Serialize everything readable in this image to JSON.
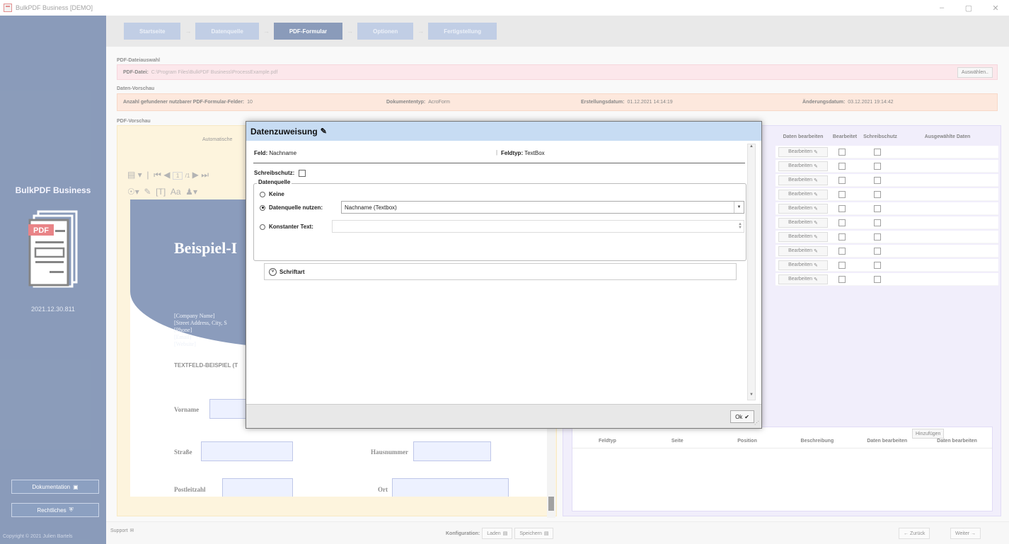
{
  "window": {
    "title": "BulkPDF Business [DEMO]",
    "minimize": "–",
    "maximize": "▢",
    "close": "✕"
  },
  "sidebar": {
    "product": "BulkPDF Business",
    "logo_badge": "PDF",
    "version": "2021.12.30.811",
    "doc_button": "Dokumentation",
    "legal_button": "Rechtliches",
    "copyright": "Copyright © 2021 Julien Bartels"
  },
  "wizard": {
    "steps": [
      "Startseite",
      "Datenquelle",
      "PDF-Formular",
      "Optionen",
      "Fertigstellung"
    ],
    "active_index": 2
  },
  "file_section": {
    "label": "PDF-Dateiauswahl",
    "field_label": "PDF-Datei:",
    "path": "C:\\Program Files\\BulkPDF Business\\ProcessExample.pdf",
    "choose_button": "Auswählen.."
  },
  "data_preview": {
    "label": "Daten-Vorschau",
    "field_count_label": "Anzahl gefundener nutzbarer PDF-Formular-Felder:",
    "field_count": "10",
    "doctype_label": "Dokumententyp:",
    "doctype": "AcroForm",
    "created_label": "Erstellungsdatum:",
    "created": "01.12.2021 14:14:19",
    "modified_label": "Änderungsdatum:",
    "modified": "03.12.2021 19:14:42"
  },
  "pdf_preview": {
    "label": "PDF-Vorschau",
    "auto_label": "Automatische",
    "page_input": "1",
    "page_total": "/1",
    "heading": "Beispiel-I",
    "company_block": "[Company Name]\n[Street Address, City, S\n[Phone]\n[Email]\n[Website]",
    "textfield_heading": "TEXTFELD-BEISPIEL (T",
    "field_labels": [
      "Vorname",
      "Straße",
      "Postleitzahl",
      "Hausnummer",
      "Ort"
    ]
  },
  "field_grid": {
    "headers": [
      "Daten bearbeiten",
      "Bearbeitet",
      "Schreibschutz",
      "Ausgewählte Daten"
    ],
    "edit_label": "Bearbeiten",
    "row_count": 10
  },
  "lower_grid": {
    "add_button": "Hinzufügen",
    "headers": [
      "Feldtyp",
      "Seite",
      "Position",
      "Beschreibung",
      "Daten bearbeiten",
      "Daten bearbeiten"
    ]
  },
  "bottom_bar": {
    "support": "Support",
    "config_label": "Konfiguration:",
    "load": "Laden",
    "save": "Speichern",
    "back": "← Zurück",
    "next": "Weiter →"
  },
  "dialog": {
    "title": "Datenzuweisung",
    "field_label": "Feld:",
    "field_value": "Nachname",
    "fieldtype_label": "Feldtyp:",
    "fieldtype_value": "TextBox",
    "readonly_label": "Schreibschutz:",
    "datasource_legend": "Datenquelle",
    "option_none": "Keine",
    "option_use": "Datenquelle nutzen:",
    "datasource_selected": "Nachname (Textbox)",
    "option_const": "Konstanter Text:",
    "const_value": "",
    "font_expander": "Schriftart",
    "ok_button": "Ok"
  }
}
